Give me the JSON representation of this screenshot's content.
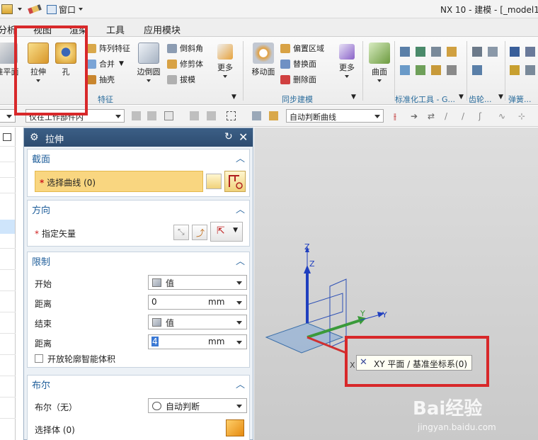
{
  "titlebar": {
    "title": "NX 10 - 建模 - [_model1",
    "window_menu": "窗口"
  },
  "tabs": [
    "分析",
    "视图",
    "渲染",
    "工具",
    "应用模块"
  ],
  "ribbon": {
    "datum_label": "准平面",
    "extrude_label": "拉伸",
    "hole_label": "孔",
    "pattern_label": "阵列特征",
    "unite_label": "合并",
    "shell_label": "抽壳",
    "edge_blend_label": "边倒圆",
    "chamfer_label": "倒斜角",
    "trim_body_label": "修剪体",
    "draft_label": "拔模",
    "more_label_1": "更多",
    "move_face_label": "移动面",
    "offset_region_label": "偏置区域",
    "replace_face_label": "替换面",
    "delete_face_label": "删除面",
    "more_label_2": "更多",
    "surface_label": "曲面",
    "group_feature": "特征",
    "group_sync": "同步建模",
    "group_std": "标准化工具 - G...",
    "group_gear": "齿轮...",
    "group_spring": "弹簧..."
  },
  "selbar": {
    "filter_value": "仅在工作部件内",
    "curve_rule": "自动判断曲线"
  },
  "dialog": {
    "title": "拉伸",
    "section": {
      "header": "截面",
      "select_curve": "选择曲线 (0)"
    },
    "direction": {
      "header": "方向",
      "specify_vector": "指定矢量"
    },
    "limits": {
      "header": "限制",
      "start_label": "开始",
      "start_value": "值",
      "distance1_label": "距离",
      "distance1_value": "0",
      "distance1_unit": "mm",
      "end_label": "结束",
      "end_value": "值",
      "distance2_label": "距离",
      "distance2_value": "4",
      "distance2_unit": "mm",
      "open_profile": "开放轮廓智能体积"
    },
    "boolean": {
      "header": "布尔",
      "bool_label": "布尔（无）",
      "bool_value": "自动判断",
      "select_body": "选择体 (0)"
    }
  },
  "viewport": {
    "axis_z1": "Z",
    "axis_z2": "Z",
    "axis_y1": "Y",
    "axis_y2": "Y",
    "axis_x": "X",
    "tooltip": "XY 平面 / 基准坐标系(0)"
  },
  "watermark": {
    "brand": "Bai经验",
    "url": "jingyan.baidu.com"
  },
  "colors": {
    "accent": "#1f5e9a",
    "highlight": "#f9d680",
    "red_frame": "#d8282a",
    "dialog_header": "#2d4c70"
  }
}
